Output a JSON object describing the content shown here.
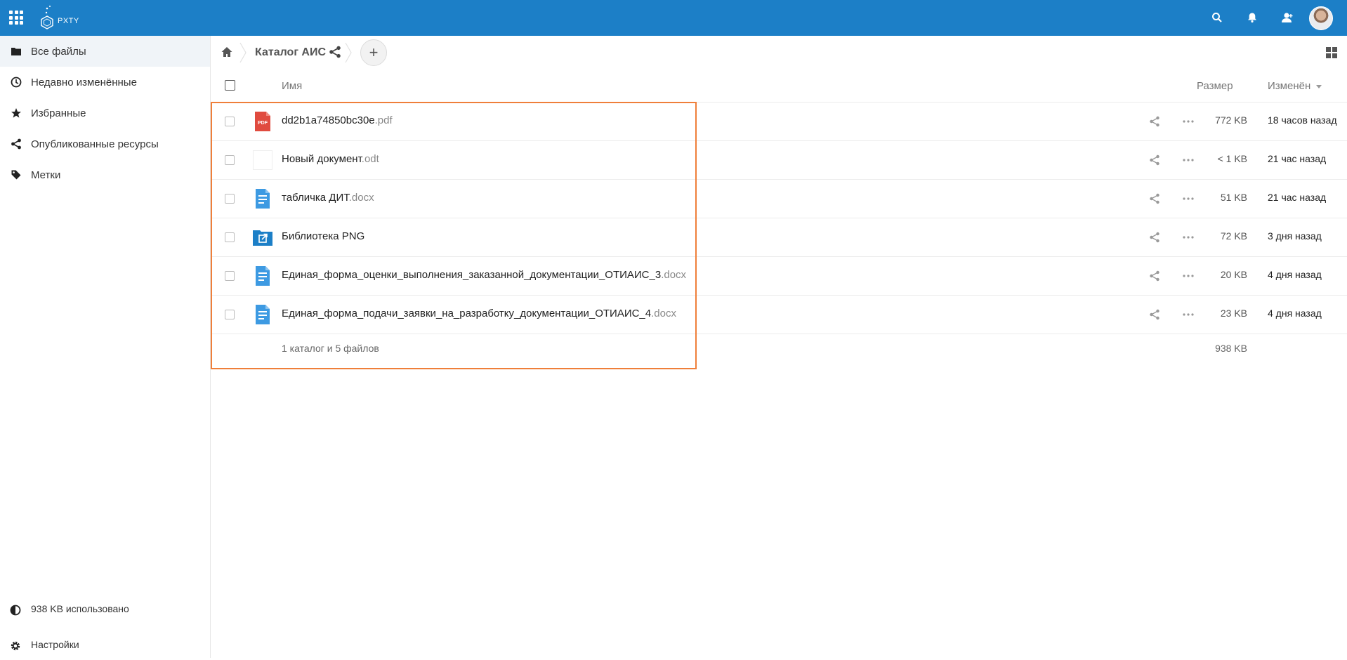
{
  "header": {
    "logo_text": "PXTY",
    "icons": [
      "apps-grid-icon",
      "search-icon",
      "bell-icon",
      "contacts-icon",
      "avatar"
    ]
  },
  "sidebar": {
    "items": [
      {
        "label": "Все файлы",
        "icon": "folder-icon",
        "active": true
      },
      {
        "label": "Недавно изменённые",
        "icon": "clock-icon"
      },
      {
        "label": "Избранные",
        "icon": "star-icon"
      },
      {
        "label": "Опубликованные ресурсы",
        "icon": "share-icon"
      },
      {
        "label": "Метки",
        "icon": "tag-icon"
      }
    ],
    "quota_label": "938 KB использовано",
    "settings_label": "Настройки"
  },
  "breadcrumb": {
    "current": "Каталог АИС",
    "add_symbol": "+"
  },
  "table": {
    "columns": {
      "name": "Имя",
      "size": "Размер",
      "modified": "Изменён"
    },
    "rows": [
      {
        "name": "dd2b1a74850bc30e",
        "ext": ".pdf",
        "type": "pdf",
        "size": "772 KB",
        "modified": "18 часов назад"
      },
      {
        "name": "Новый документ",
        "ext": ".odt",
        "type": "blank",
        "size": "< 1 KB",
        "modified": "21 час назад"
      },
      {
        "name": "табличка ДИТ",
        "ext": ".docx",
        "type": "doc",
        "size": "51 KB",
        "modified": "21 час назад"
      },
      {
        "name": "Библиотека PNG",
        "ext": "",
        "type": "shared-folder",
        "size": "72 KB",
        "modified": "3 дня назад"
      },
      {
        "name": "Единая_форма_оценки_выполнения_заказанной_документации_ОТИАИС_3",
        "ext": ".docx",
        "type": "doc",
        "size": "20 KB",
        "modified": "4 дня назад"
      },
      {
        "name": "Единая_форма_подачи_заявки_на_разработку_документации_ОТИАИС_4",
        "ext": ".docx",
        "type": "doc",
        "size": "23 KB",
        "modified": "4 дня назад"
      }
    ],
    "summary": {
      "text": "1 каталог и 5 файлов",
      "total_size": "938 KB"
    }
  },
  "colors": {
    "header_bg": "#1c7fc7",
    "highlight": "#ef7f3a",
    "pdf": "#e04b3f",
    "doc": "#3d9ae2",
    "folder": "#1c7fc7"
  }
}
